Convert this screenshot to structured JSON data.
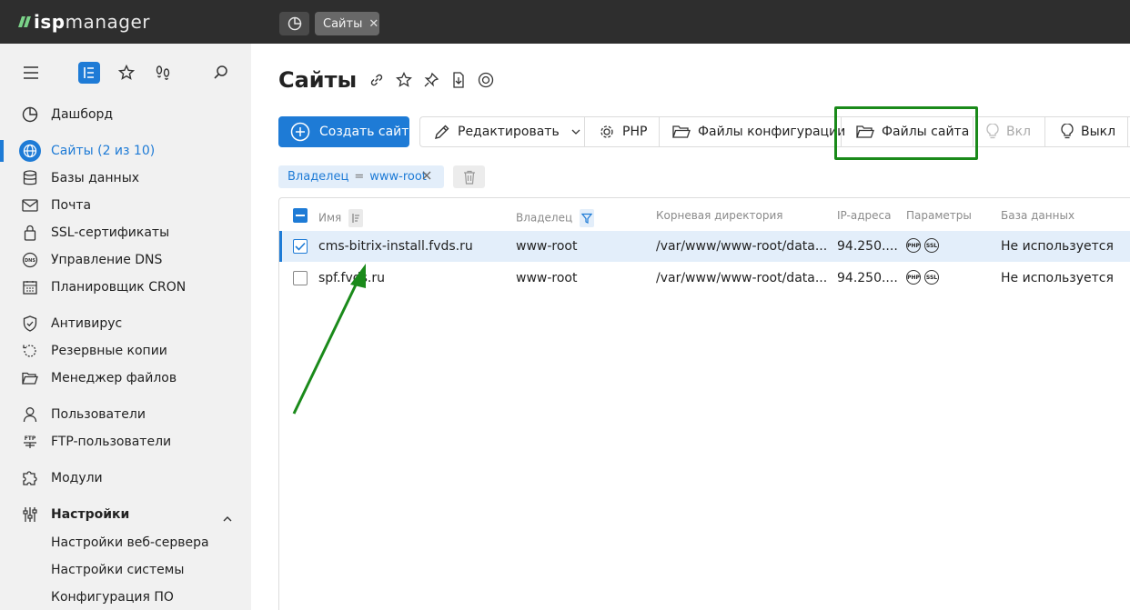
{
  "app": {
    "brand_prefix": "isp",
    "brand_suffix": "manager"
  },
  "tabs": [
    {
      "label": "Сайты"
    }
  ],
  "sidebar": {
    "items": [
      {
        "label": "Дашборд"
      },
      {
        "label": "Сайты (2 из 10)"
      },
      {
        "label": "Базы данных"
      },
      {
        "label": "Почта"
      },
      {
        "label": "SSL-сертификаты"
      },
      {
        "label": "Управление DNS"
      },
      {
        "label": "Планировщик CRON"
      },
      {
        "label": "Антивирус"
      },
      {
        "label": "Резервные копии"
      },
      {
        "label": "Менеджер файлов"
      },
      {
        "label": "Пользователи"
      },
      {
        "label": "FTP-пользователи"
      },
      {
        "label": "Модули"
      },
      {
        "label": "Настройки"
      },
      {
        "label": "Настройки веб-сервера"
      },
      {
        "label": "Настройки системы"
      },
      {
        "label": "Конфигурация ПО"
      }
    ]
  },
  "main": {
    "title": "Сайты",
    "toolbar": {
      "create": "Создать сайт",
      "edit": "Редактировать",
      "php": "PHP",
      "config_files": "Файлы конфигурации",
      "site_files": "Файлы сайта",
      "on": "Вкл",
      "off": "Выкл"
    },
    "filter": {
      "field": "Владелец",
      "op": "=",
      "value": "www-root"
    },
    "table": {
      "headers": [
        "Имя",
        "Владелец",
        "Корневая директория",
        "IP-адреса",
        "Параметры",
        "База данных"
      ],
      "rows": [
        {
          "name": "cms-bitrix-install.fvds.ru",
          "owner": "www-root",
          "root": "/var/www/www-root/data...",
          "ip": "94.250....",
          "php": "PHP",
          "ssl": "SSL",
          "db": "Не используется",
          "selected": true
        },
        {
          "name": "spf.fvds.ru",
          "owner": "www-root",
          "root": "/var/www/www-root/data...",
          "ip": "94.250....",
          "php": "PHP",
          "ssl": "SSL",
          "db": "Не используется",
          "selected": false
        }
      ]
    }
  },
  "colors": {
    "accent": "#1e7bd6",
    "topbar": "#2e2e2e",
    "sidebar": "#f1f1f1",
    "annotation": "#1a8a1a"
  }
}
